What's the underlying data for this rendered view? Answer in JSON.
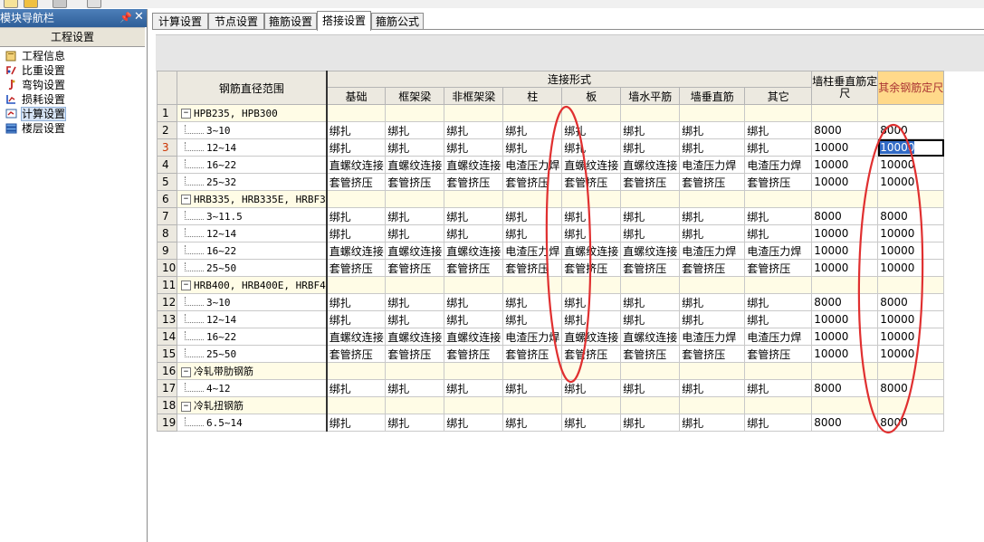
{
  "navigator": {
    "title": "模块导航栏",
    "section": "工程设置",
    "items": [
      {
        "label": "工程信息",
        "icon": "project-info-icon"
      },
      {
        "label": "比重设置",
        "icon": "weight-icon"
      },
      {
        "label": "弯钩设置",
        "icon": "hook-icon"
      },
      {
        "label": "损耗设置",
        "icon": "loss-icon"
      },
      {
        "label": "计算设置",
        "icon": "calc-icon",
        "selected": true
      },
      {
        "label": "楼层设置",
        "icon": "floor-icon"
      }
    ]
  },
  "tabs": [
    "计算设置",
    "节点设置",
    "箍筋设置",
    "搭接设置",
    "箍筋公式"
  ],
  "active_tab": 3,
  "grid": {
    "header_name": "钢筋直径范围",
    "header_group": "连接形式",
    "columns": [
      "基础",
      "框架梁",
      "非框架梁",
      "柱",
      "板",
      "墙水平筋",
      "墙垂直筋",
      "其它"
    ],
    "wall_col": "墙柱垂直筋定尺",
    "other_col": "其余钢筋定尺",
    "rows": [
      {
        "n": "1",
        "name": "HPB235, HPB300",
        "group": true
      },
      {
        "n": "2",
        "name": "3~10",
        "cells": [
          "绑扎",
          "绑扎",
          "绑扎",
          "绑扎",
          "绑扎",
          "绑扎",
          "绑扎",
          "绑扎"
        ],
        "wall": "8000",
        "other": "8000"
      },
      {
        "n": "3",
        "name": "12~14",
        "cells": [
          "绑扎",
          "绑扎",
          "绑扎",
          "绑扎",
          "绑扎",
          "绑扎",
          "绑扎",
          "绑扎"
        ],
        "wall": "10000",
        "other": "10000",
        "current": true
      },
      {
        "n": "4",
        "name": "16~22",
        "cells": [
          "直螺纹连接",
          "直螺纹连接",
          "直螺纹连接",
          "电渣压力焊",
          "直螺纹连接",
          "直螺纹连接",
          "电渣压力焊",
          "电渣压力焊"
        ],
        "wall": "10000",
        "other": "10000"
      },
      {
        "n": "5",
        "name": "25~32",
        "cells": [
          "套管挤压",
          "套管挤压",
          "套管挤压",
          "套管挤压",
          "套管挤压",
          "套管挤压",
          "套管挤压",
          "套管挤压"
        ],
        "wall": "10000",
        "other": "10000"
      },
      {
        "n": "6",
        "name": "HRB335, HRB335E, HRBF3",
        "group": true
      },
      {
        "n": "7",
        "name": "3~11.5",
        "cells": [
          "绑扎",
          "绑扎",
          "绑扎",
          "绑扎",
          "绑扎",
          "绑扎",
          "绑扎",
          "绑扎"
        ],
        "wall": "8000",
        "other": "8000"
      },
      {
        "n": "8",
        "name": "12~14",
        "cells": [
          "绑扎",
          "绑扎",
          "绑扎",
          "绑扎",
          "绑扎",
          "绑扎",
          "绑扎",
          "绑扎"
        ],
        "wall": "10000",
        "other": "10000"
      },
      {
        "n": "9",
        "name": "16~22",
        "cells": [
          "直螺纹连接",
          "直螺纹连接",
          "直螺纹连接",
          "电渣压力焊",
          "直螺纹连接",
          "直螺纹连接",
          "电渣压力焊",
          "电渣压力焊"
        ],
        "wall": "10000",
        "other": "10000"
      },
      {
        "n": "10",
        "name": "25~50",
        "cells": [
          "套管挤压",
          "套管挤压",
          "套管挤压",
          "套管挤压",
          "套管挤压",
          "套管挤压",
          "套管挤压",
          "套管挤压"
        ],
        "wall": "10000",
        "other": "10000"
      },
      {
        "n": "11",
        "name": "HRB400, HRB400E, HRBF4",
        "group": true
      },
      {
        "n": "12",
        "name": "3~10",
        "cells": [
          "绑扎",
          "绑扎",
          "绑扎",
          "绑扎",
          "绑扎",
          "绑扎",
          "绑扎",
          "绑扎"
        ],
        "wall": "8000",
        "other": "8000"
      },
      {
        "n": "13",
        "name": "12~14",
        "cells": [
          "绑扎",
          "绑扎",
          "绑扎",
          "绑扎",
          "绑扎",
          "绑扎",
          "绑扎",
          "绑扎"
        ],
        "wall": "10000",
        "other": "10000"
      },
      {
        "n": "14",
        "name": "16~22",
        "cells": [
          "直螺纹连接",
          "直螺纹连接",
          "直螺纹连接",
          "电渣压力焊",
          "直螺纹连接",
          "直螺纹连接",
          "电渣压力焊",
          "电渣压力焊"
        ],
        "wall": "10000",
        "other": "10000"
      },
      {
        "n": "15",
        "name": "25~50",
        "cells": [
          "套管挤压",
          "套管挤压",
          "套管挤压",
          "套管挤压",
          "套管挤压",
          "套管挤压",
          "套管挤压",
          "套管挤压"
        ],
        "wall": "10000",
        "other": "10000"
      },
      {
        "n": "16",
        "name": "冷轧带肋钢筋",
        "group": true
      },
      {
        "n": "17",
        "name": "4~12",
        "cells": [
          "绑扎",
          "绑扎",
          "绑扎",
          "绑扎",
          "绑扎",
          "绑扎",
          "绑扎",
          "绑扎"
        ],
        "wall": "8000",
        "other": "8000"
      },
      {
        "n": "18",
        "name": "冷轧扭钢筋",
        "group": true
      },
      {
        "n": "19",
        "name": "6.5~14",
        "cells": [
          "绑扎",
          "绑扎",
          "绑扎",
          "绑扎",
          "绑扎",
          "绑扎",
          "绑扎",
          "绑扎"
        ],
        "wall": "8000",
        "other": "8000"
      }
    ]
  },
  "colors": {
    "header_bg": "#ece9e0",
    "highlight_header": "#ffd98a",
    "group_row": "#fffce6",
    "annotation": "#e03030"
  }
}
